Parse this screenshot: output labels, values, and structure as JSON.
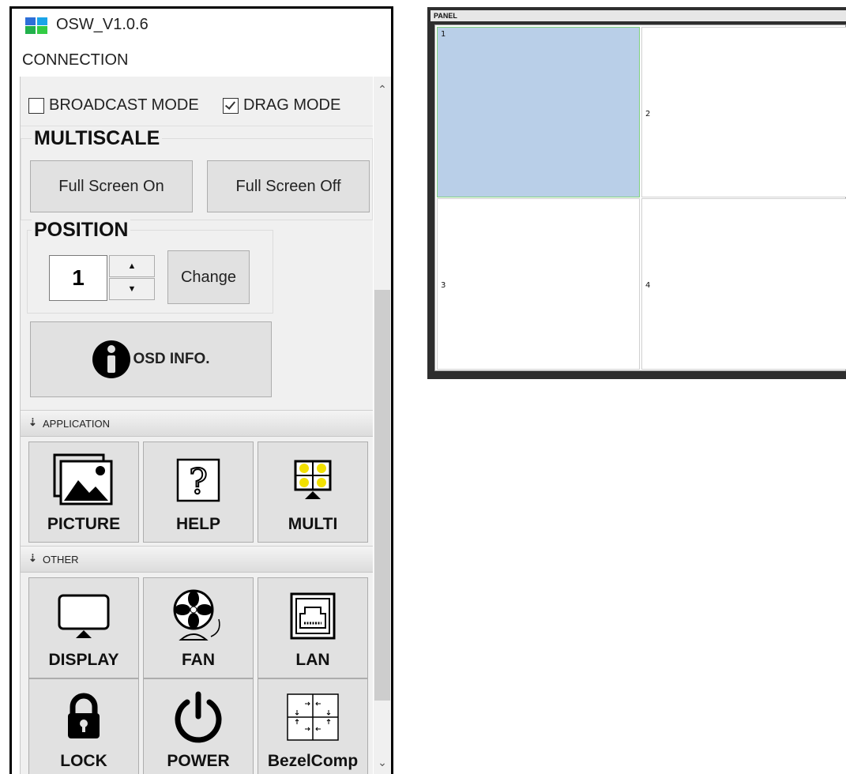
{
  "app": {
    "title": "OSW_V1.0.6",
    "menu": [
      "CONNECTION"
    ],
    "colors": {
      "logo": [
        "#2e6fd8",
        "#1aa4e8",
        "#22b14c",
        "#33cc44"
      ],
      "selected_cell": "#b9cfe8"
    }
  },
  "modes": {
    "broadcast": {
      "label": "BROADCAST MODE",
      "checked": false
    },
    "drag": {
      "label": "DRAG MODE",
      "checked": true
    }
  },
  "multiscale": {
    "title": "MULTISCALE",
    "full_on": "Full Screen On",
    "full_off": "Full Screen Off"
  },
  "position": {
    "title": "POSITION",
    "value": "1",
    "change": "Change"
  },
  "osd": {
    "label": "OSD INFO.",
    "icon": "info-icon"
  },
  "application": {
    "label": "APPLICATION",
    "items": [
      {
        "label": "PICTURE",
        "icon": "picture-icon"
      },
      {
        "label": "HELP",
        "icon": "help-icon"
      },
      {
        "label": "MULTI",
        "icon": "multi-icon"
      }
    ]
  },
  "other": {
    "label": "OTHER",
    "items": [
      {
        "label": "DISPLAY",
        "icon": "display-icon"
      },
      {
        "label": "FAN",
        "icon": "fan-icon"
      },
      {
        "label": "LAN",
        "icon": "lan-icon"
      },
      {
        "label": "LOCK",
        "icon": "lock-icon"
      },
      {
        "label": "POWER",
        "icon": "power-icon"
      },
      {
        "label": "BezelComp",
        "icon": "bezel-comp-icon"
      }
    ]
  },
  "panel": {
    "title": "PANEL",
    "cells": [
      "1",
      "2",
      "3",
      "4"
    ],
    "selected": "1"
  }
}
